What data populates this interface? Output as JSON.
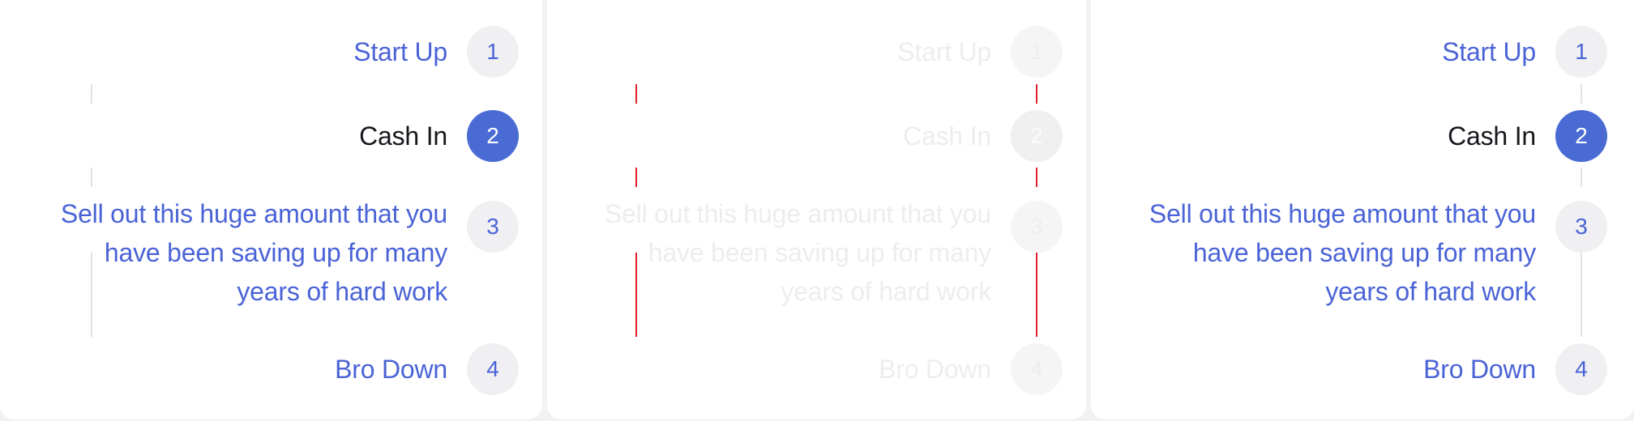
{
  "stepper_panels": [
    {
      "steps": [
        {
          "number": "1",
          "label": "Start Up"
        },
        {
          "number": "2",
          "label": "Cash In"
        },
        {
          "number": "3",
          "label": "Sell out this huge amount that you have been saving up for many years of hard work"
        },
        {
          "number": "4",
          "label": "Bro Down"
        }
      ],
      "active_step": 2
    },
    {
      "steps": [
        {
          "number": "1",
          "label": "Start Up"
        },
        {
          "number": "2",
          "label": "Cash In"
        },
        {
          "number": "3",
          "label": "Sell out this huge amount that you have been saving up for many years of hard work"
        },
        {
          "number": "4",
          "label": "Bro Down"
        }
      ],
      "active_step": 2
    },
    {
      "steps": [
        {
          "number": "1",
          "label": "Start Up"
        },
        {
          "number": "2",
          "label": "Cash In"
        },
        {
          "number": "3",
          "label": "Sell out this huge amount that you have been saving up for many years of hard work"
        },
        {
          "number": "4",
          "label": "Bro Down"
        }
      ],
      "active_step": 2
    }
  ],
  "colors": {
    "accent": "#4a63d6",
    "active_circle": "#4a6bd4",
    "active_label": "#16181d",
    "circle_bg": "#f0f0f2",
    "connector": "#e3e3e6",
    "debug_connector": "#e11f26",
    "page_bg": "#f2f2f4"
  }
}
